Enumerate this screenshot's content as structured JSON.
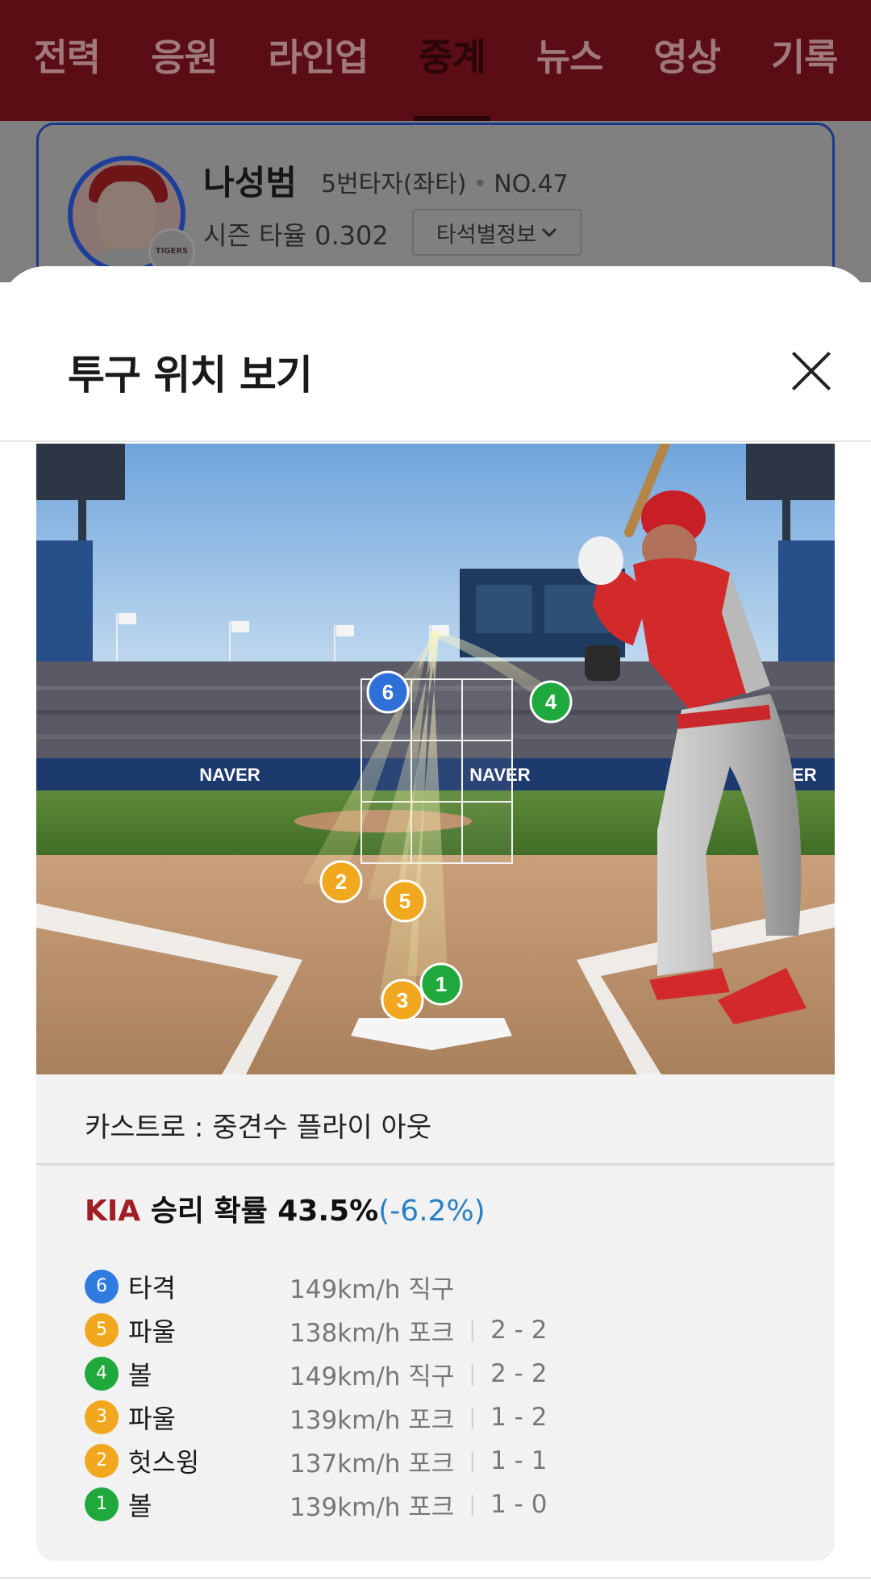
{
  "nav": {
    "tabs": [
      {
        "label": "전력",
        "active": false
      },
      {
        "label": "응원",
        "active": false
      },
      {
        "label": "라인업",
        "active": false
      },
      {
        "label": "중계",
        "active": true
      },
      {
        "label": "뉴스",
        "active": false
      },
      {
        "label": "영상",
        "active": false
      },
      {
        "label": "기록",
        "active": false
      }
    ]
  },
  "player": {
    "name": "나성범",
    "order": "5번타자(좌타)",
    "number": "NO.47",
    "season_avg": "시즌 타율 0.302",
    "info_button": "타석별정보",
    "badge_icon": "tigers-logo-icon"
  },
  "sheet": {
    "title": "투구 위치 보기",
    "close_icon": "close-icon"
  },
  "field": {
    "markers": [
      {
        "num": "6",
        "color": "#2f6fd8"
      },
      {
        "num": "4",
        "color": "#1fa83c"
      },
      {
        "num": "2",
        "color": "#f2a81e"
      },
      {
        "num": "5",
        "color": "#f2a81e"
      },
      {
        "num": "3",
        "color": "#f2a81e"
      },
      {
        "num": "1",
        "color": "#1fa83c"
      }
    ],
    "signage": "NAVER"
  },
  "result": {
    "play": "카스트로 : 중견수 플라이 아웃",
    "team": "KIA",
    "win_prob_label": "승리 확률 43.5%",
    "win_prob_delta": "(-6.2%)"
  },
  "pitches": [
    {
      "num": "6",
      "color": "#2f7be0",
      "result": "타격",
      "info": "149km/h  직구",
      "count": ""
    },
    {
      "num": "5",
      "color": "#f2a81e",
      "result": "파울",
      "info": "138km/h  포크",
      "count": "2 - 2"
    },
    {
      "num": "4",
      "color": "#1fa83c",
      "result": "볼",
      "info": "149km/h  직구",
      "count": "2 - 2"
    },
    {
      "num": "3",
      "color": "#f2a81e",
      "result": "파울",
      "info": "139km/h  포크",
      "count": "1 - 2"
    },
    {
      "num": "2",
      "color": "#f2a81e",
      "result": "헛스윙",
      "info": "137km/h  포크",
      "count": "1 - 1"
    },
    {
      "num": "1",
      "color": "#1fa83c",
      "result": "볼",
      "info": "139km/h  포크",
      "count": "1 - 0"
    }
  ],
  "colors": {
    "nav_bg": "#5a0d14",
    "team_red": "#a01e24",
    "delta_blue": "#2a7fc4"
  }
}
